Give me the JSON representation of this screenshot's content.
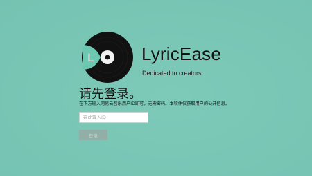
{
  "app": {
    "name": "LyricEase",
    "tagline": "Dedicated to creators.",
    "logo_letter": "L"
  },
  "login": {
    "heading": "请先登录。",
    "description": "在下方输入网易云音乐用户ID即可，无需密码。本软件仅获取用户的公开信息。",
    "input_placeholder": "在此输入ID",
    "input_value": "",
    "button_label": "登录",
    "button_enabled": false
  },
  "colors": {
    "background": "#7ecab9",
    "logo_disc": "#111111",
    "logo_accent": "#6dc8b2",
    "button_disabled_bg": "#91aea7",
    "button_disabled_text": "#c6d8d3"
  },
  "icons": {
    "logo": "vinyl-record-with-letter-L-icon"
  }
}
